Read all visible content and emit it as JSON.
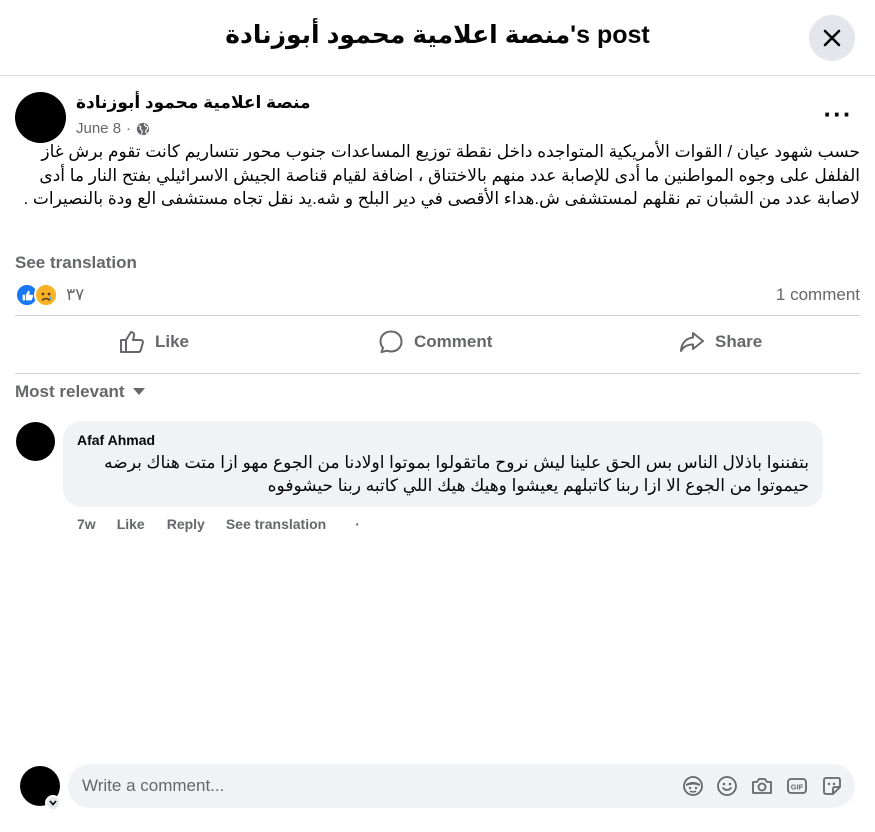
{
  "header": {
    "title": "منصة اعلامية محمود أبوزنادة's post"
  },
  "post": {
    "author": "منصة اعلامية محمود أبوزنادة",
    "date": "June 8",
    "dot": "·",
    "audience_icon": "globe-icon",
    "menu_icon": "more-options-icon",
    "body": "حسب شهود عيان / القوات الأمريكية المتواجده داخل نقطة توزيع المساعدات جنوب محور نتساريم كانت تقوم برش غاز الفلفل على وجوه المواطنين ما أدى للإصابة عدد منهم بالاختناق ، اضافة لقيام قناصة الجيش الاسرائيلي بفتح النار ما أدى لاصابة عدد من الشبان تم نقلهم لمستشفى ش.هداء الأقصى في دير البلح و شه.يد نقل تجاه مستشفى الع ودة بالنصيرات  .",
    "see_translation": "See translation",
    "reactions": {
      "count": "٣٧",
      "types": [
        "like",
        "sad"
      ]
    },
    "comment_count": "1 comment"
  },
  "actions": {
    "like": "Like",
    "comment": "Comment",
    "share": "Share"
  },
  "sort": {
    "label": "Most relevant"
  },
  "comments": [
    {
      "author": "Afaf Ahmad",
      "text": "بتفننوا باذلال الناس بس الحق علينا ليش نروح ماتقولوا بموتوا اولادنا من الجوع مهو ازا متت هناك برضه حيموتوا من الجوع الا ازا ربنا كاتبلهم يعيشوا وهيك هيك اللي كاتبه ربنا حيشوفوه",
      "time": "7w",
      "like": "Like",
      "reply": "Reply",
      "see_translation": "See translation",
      "dot": "·"
    }
  ],
  "composer": {
    "placeholder": "Write a comment...",
    "icons": [
      "avatar-sticker-icon",
      "emoji-icon",
      "camera-icon",
      "gif-icon",
      "sticker-icon"
    ]
  },
  "colors": {
    "accent": "#1877f2",
    "muted": "#65676b",
    "bubble": "#f0f2f5",
    "sad": "#f7b125"
  }
}
